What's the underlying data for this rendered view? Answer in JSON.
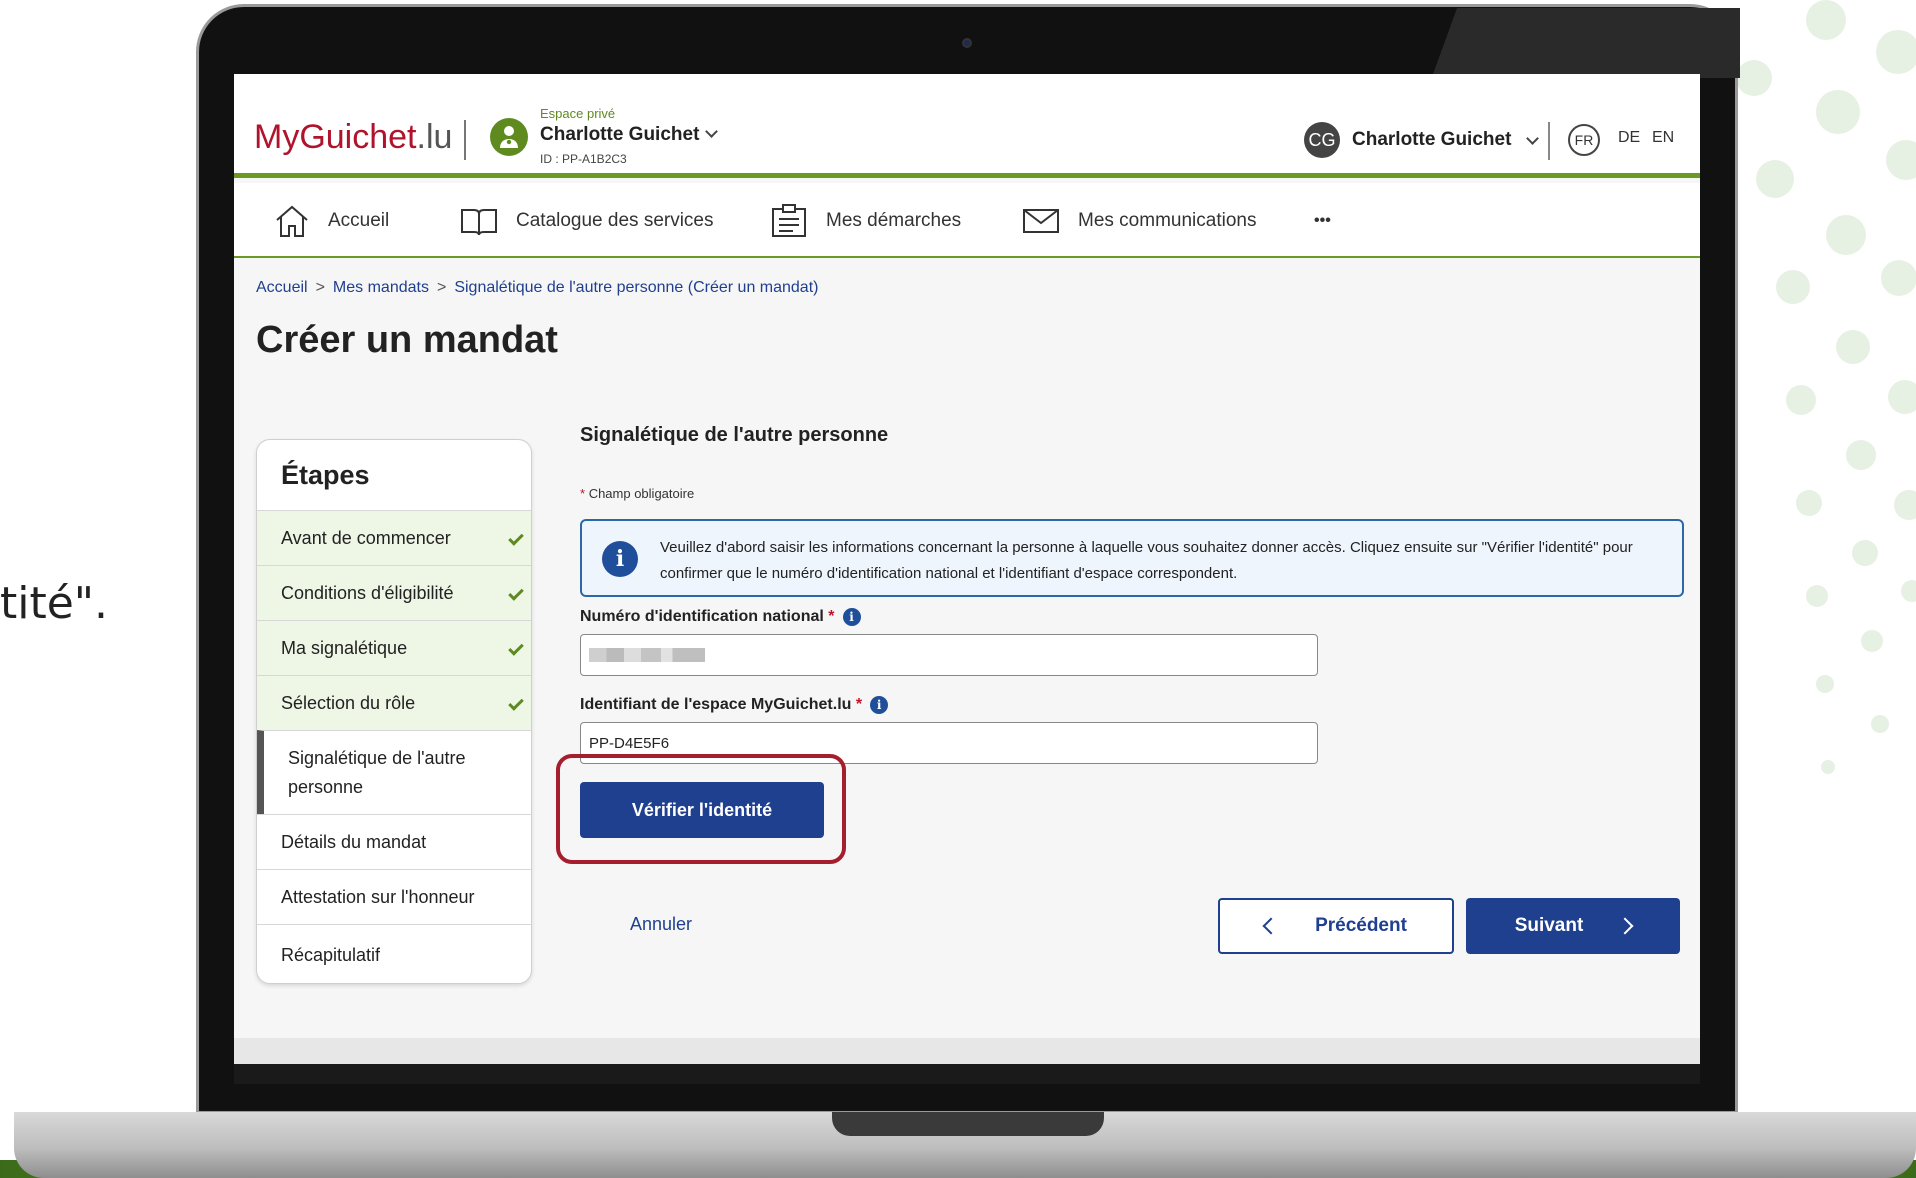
{
  "caption": "tité\".",
  "header": {
    "logo_main": "MyGuichet",
    "logo_suffix": ".lu",
    "space_label": "Espace privé",
    "space_name": "Charlotte Guichet",
    "space_id": "ID : PP-A1B2C3",
    "user_initials": "CG",
    "user_name": "Charlotte Guichet",
    "languages": [
      "FR",
      "DE",
      "EN"
    ],
    "active_language": "FR"
  },
  "nav": {
    "home": "Accueil",
    "catalogue": "Catalogue des services",
    "procedures": "Mes démarches",
    "communications": "Mes communications",
    "more": "•••"
  },
  "breadcrumb": {
    "home": "Accueil",
    "mandates": "Mes mandats",
    "current": "Signalétique de l'autre personne (Créer un mandat)"
  },
  "page_title": "Créer un mandat",
  "steps": {
    "title": "Étapes",
    "items": [
      {
        "label": "Avant de commencer",
        "status": "done"
      },
      {
        "label": "Conditions d'éligibilité",
        "status": "done"
      },
      {
        "label": "Ma signalétique",
        "status": "done"
      },
      {
        "label": "Sélection du rôle",
        "status": "done"
      },
      {
        "label": "Signalétique de l'autre personne",
        "status": "current"
      },
      {
        "label": "Détails du mandat",
        "status": "todo"
      },
      {
        "label": "Attestation sur l'honneur",
        "status": "todo"
      },
      {
        "label": "Récapitulatif",
        "status": "todo"
      }
    ]
  },
  "form": {
    "section_title": "Signalétique de l'autre personne",
    "required_note": "Champ obligatoire",
    "required_marker": "*",
    "info_text": "Veuillez d'abord saisir les informations concernant la personne à laquelle vous souhaitez donner accès. Cliquez ensuite sur \"Vérifier l'identité\" pour confirmer que le numéro d'identification national et l'identifiant d'espace correspondent.",
    "national_id_label": "Numéro d'identification national",
    "space_id_label": "Identifiant de l'espace MyGuichet.lu",
    "space_id_value": "PP-D4E5F6",
    "verify_button": "Vérifier l'identité"
  },
  "footer_actions": {
    "cancel": "Annuler",
    "previous": "Précédent",
    "next": "Suivant"
  },
  "colors": {
    "brand_green": "#6a9a22",
    "primary_blue": "#1f3f8f",
    "highlight_red": "#a61d2d",
    "logo_red": "#b0132c"
  }
}
